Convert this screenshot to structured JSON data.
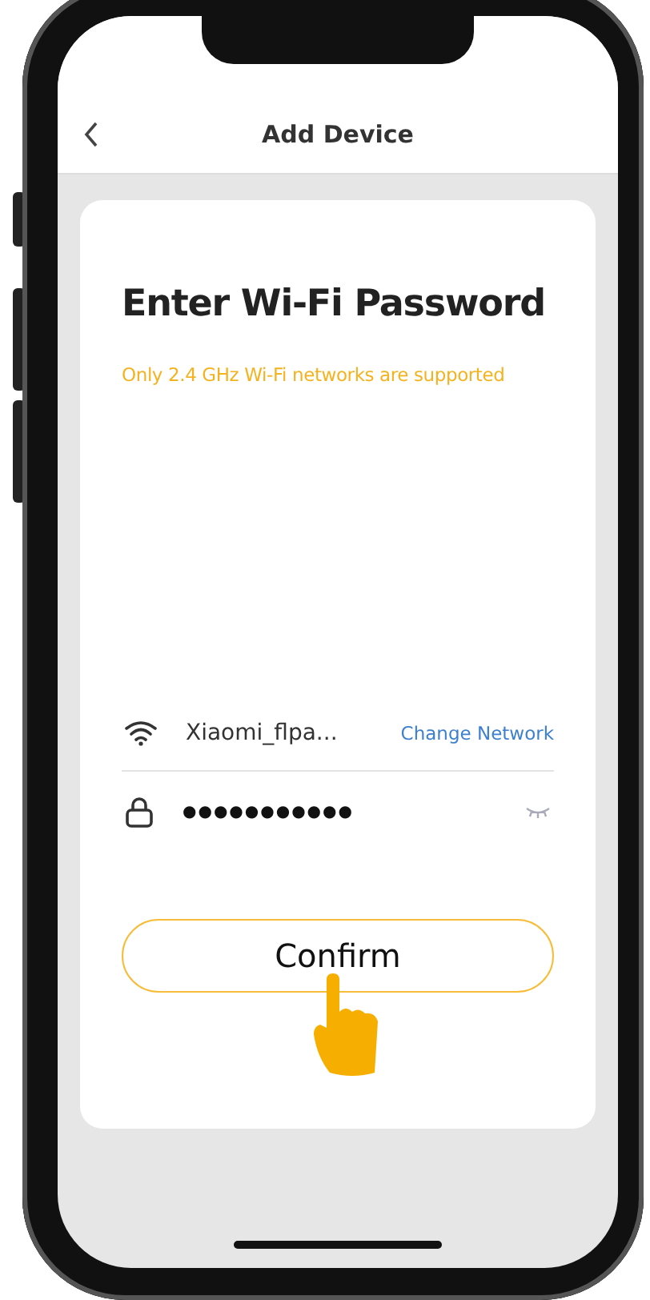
{
  "header": {
    "title": "Add Device"
  },
  "card": {
    "title": "Enter Wi-Fi Password",
    "notice": "Only 2.4 GHz Wi-Fi networks are supported",
    "network": {
      "name": "Xiaomi_flpa...",
      "action": "Change Network"
    },
    "password": {
      "value": "●●●●●●●●●●●"
    },
    "confirm": "Confirm"
  }
}
